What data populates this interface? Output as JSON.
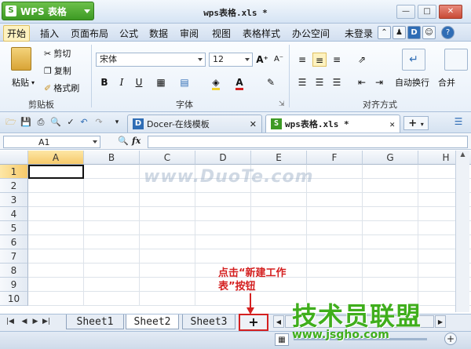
{
  "app": {
    "name": "WPS 表格",
    "logo": "S",
    "document_title": "wps表格.xls *"
  },
  "menu": [
    "开始",
    "插入",
    "页面布局",
    "公式",
    "数据",
    "审阅",
    "视图",
    "表格样式",
    "办公空间"
  ],
  "account": {
    "login": "未登录",
    "badge": "D"
  },
  "ribbon": {
    "clipboard": {
      "paste": "粘贴",
      "cut": "剪切",
      "copy": "复制",
      "format_painter": "格式刷",
      "label": "剪贴板"
    },
    "font": {
      "name": "宋体",
      "size": "12",
      "bold": "B",
      "italic": "I",
      "underline": "U",
      "grow": "A⁺",
      "shrink": "A⁻",
      "font_color": "A",
      "label": "字体"
    },
    "alignment": {
      "wrap": "自动换行",
      "merge": "合并",
      "label": "对齐方式"
    }
  },
  "doc_tabs": [
    {
      "label": "Docer-在线模板",
      "icon": "D"
    },
    {
      "label": "wps表格.xls *",
      "icon": "S"
    }
  ],
  "formula_bar": {
    "cell_ref": "A1",
    "fx": "fx",
    "value": ""
  },
  "grid": {
    "columns": [
      "A",
      "B",
      "C",
      "D",
      "E",
      "F",
      "G",
      "H"
    ],
    "rows": [
      "1",
      "2",
      "3",
      "4",
      "5",
      "6",
      "7",
      "8",
      "9",
      "10"
    ],
    "selected": "A1"
  },
  "watermark": "www.DuoTe.com",
  "sheets": [
    {
      "label": "Sheet1",
      "active": false
    },
    {
      "label": "Sheet2",
      "active": true
    },
    {
      "label": "Sheet3",
      "active": false
    }
  ],
  "new_sheet": {
    "label": "+"
  },
  "annotation": {
    "line1": "点击“新建工作",
    "line2": "表”按钮"
  },
  "brand": {
    "name": "技术员联盟",
    "url": "www.jsgho.com"
  },
  "colors": {
    "accent_green": "#3d9a24",
    "annotation_red": "#d42020"
  }
}
